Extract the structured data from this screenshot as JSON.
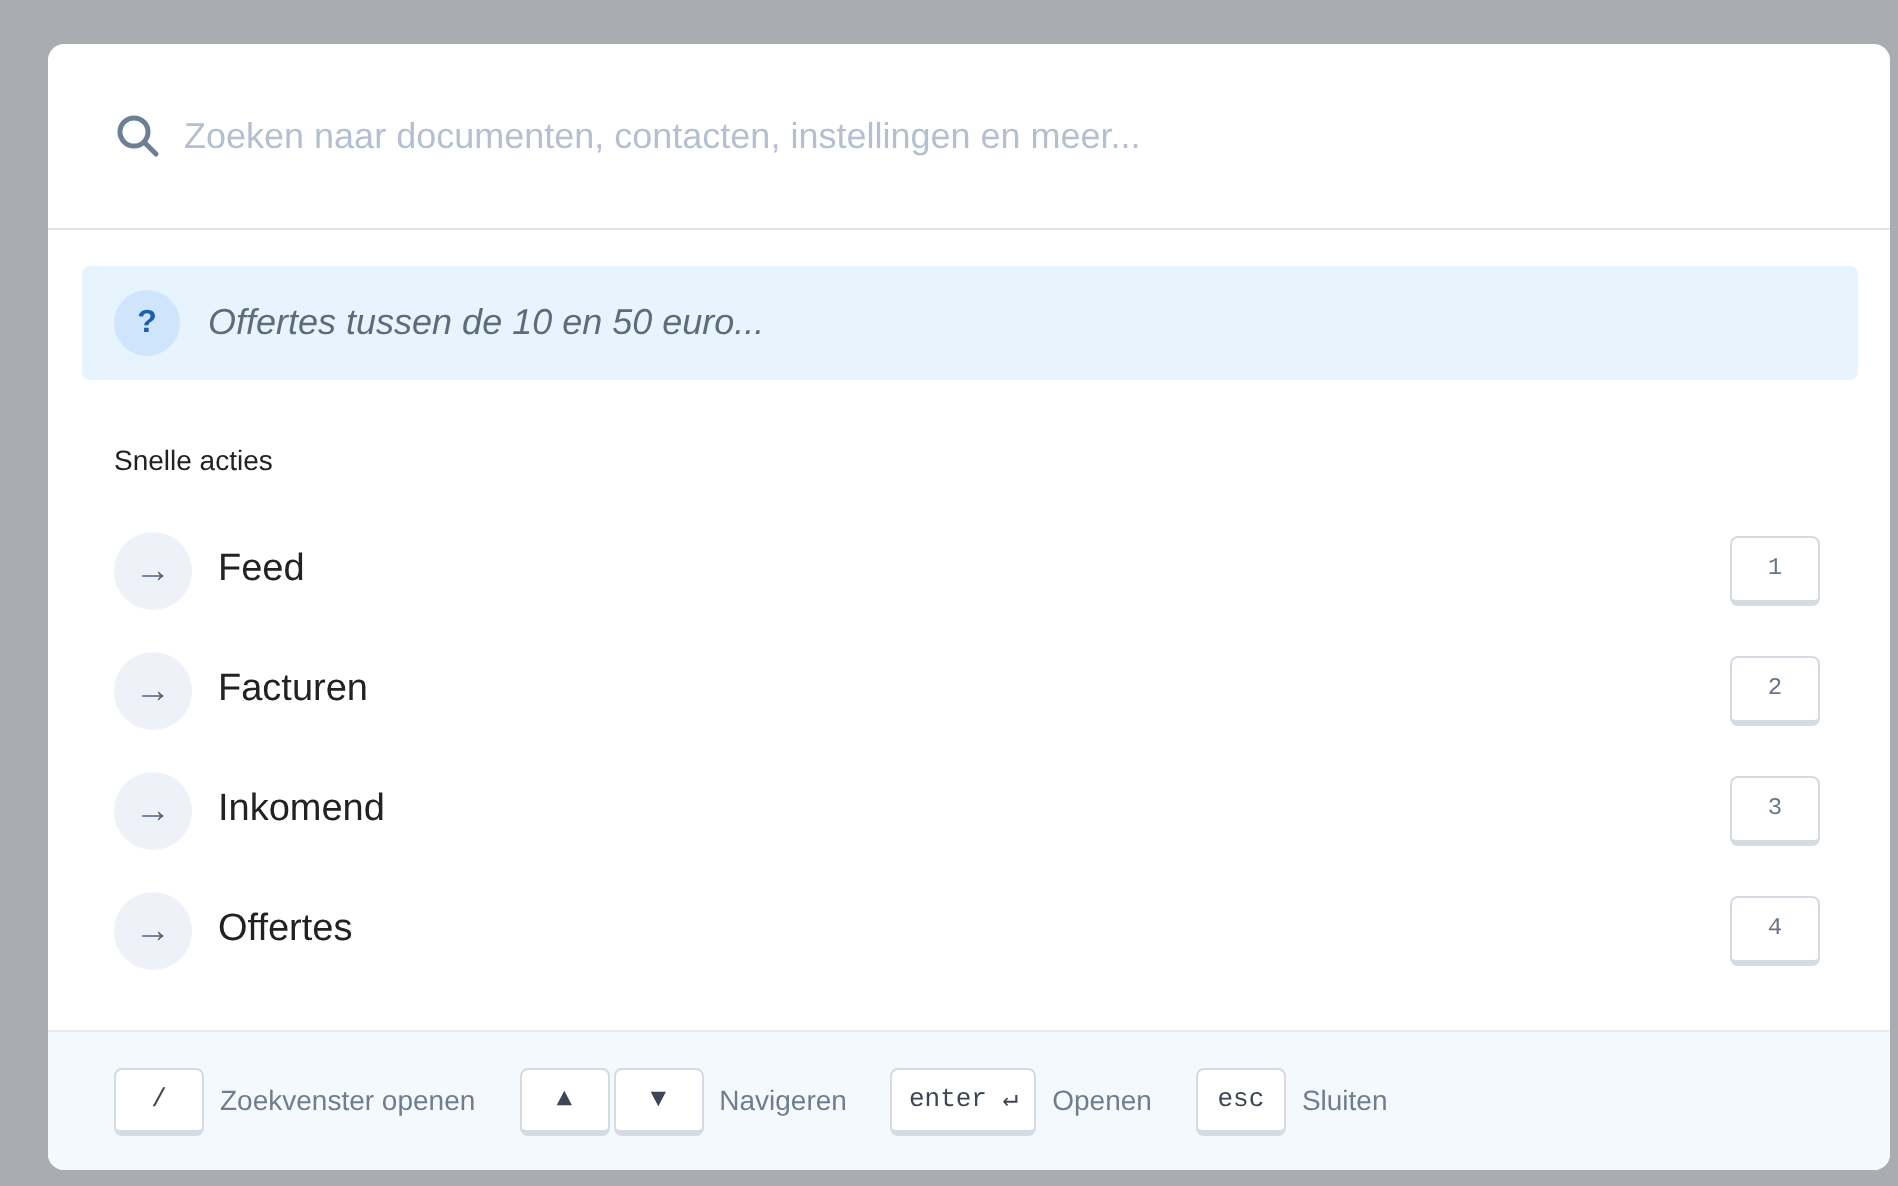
{
  "search": {
    "placeholder": "Zoeken naar documenten, contacten, instellingen en meer..."
  },
  "hint": {
    "icon": "?",
    "text": "Offertes tussen de 10 en 50 euro..."
  },
  "section": {
    "title": "Snelle acties"
  },
  "actions": [
    {
      "icon": "→",
      "label": "Feed",
      "key": "1"
    },
    {
      "icon": "→",
      "label": "Facturen",
      "key": "2"
    },
    {
      "icon": "→",
      "label": "Inkomend",
      "key": "3"
    },
    {
      "icon": "→",
      "label": "Offertes",
      "key": "4"
    }
  ],
  "footer": [
    {
      "keys": [
        "/"
      ],
      "label": "Zoekvenster openen"
    },
    {
      "keys": [
        "▲",
        "▼"
      ],
      "label": "Navigeren"
    },
    {
      "keys": [
        "enter ↵"
      ],
      "label": "Openen"
    },
    {
      "keys": [
        "esc"
      ],
      "label": "Sluiten"
    }
  ]
}
